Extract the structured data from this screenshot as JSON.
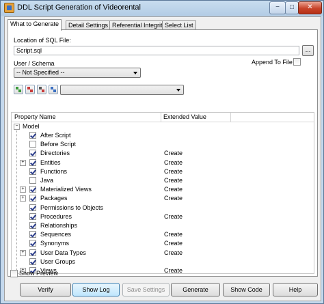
{
  "window": {
    "title": "DDL Script Generation of Videorental",
    "minimize": "−",
    "maximize": "□",
    "close": "✕"
  },
  "tabs": [
    {
      "label": "What to Generate",
      "active": true
    },
    {
      "label": "Detail Settings",
      "active": false
    },
    {
      "label": "Referential Integrity",
      "active": false
    },
    {
      "label": "Select List",
      "active": false
    }
  ],
  "sql_file": {
    "label": "Location of SQL File:",
    "value": "Script.sql",
    "browse_label": "..."
  },
  "schema": {
    "label": "User / Schema",
    "value": "-- Not Specified --"
  },
  "append": {
    "label": "Append To File",
    "checked": false
  },
  "toolbar": {
    "icons": [
      "select-all-icon",
      "deselect-all-icon",
      "expand-icon",
      "options-icon"
    ],
    "combo_value": ""
  },
  "grid": {
    "columns": [
      "Property Name",
      "Extended Value"
    ],
    "root": "Model",
    "rows": [
      {
        "name": "After Script",
        "checked": true,
        "value": "",
        "expandable": false
      },
      {
        "name": "Before Script",
        "checked": false,
        "value": "",
        "expandable": false
      },
      {
        "name": "Directories",
        "checked": true,
        "value": "Create",
        "expandable": false
      },
      {
        "name": "Entities",
        "checked": true,
        "value": "Create",
        "expandable": true
      },
      {
        "name": "Functions",
        "checked": true,
        "value": "Create",
        "expandable": false
      },
      {
        "name": "Java",
        "checked": false,
        "value": "Create",
        "expandable": false
      },
      {
        "name": "Materialized Views",
        "checked": true,
        "value": "Create",
        "expandable": true
      },
      {
        "name": "Packages",
        "checked": true,
        "value": "Create",
        "expandable": true
      },
      {
        "name": "Permissions to Objects",
        "checked": true,
        "value": "",
        "expandable": false
      },
      {
        "name": "Procedures",
        "checked": true,
        "value": "Create",
        "expandable": false
      },
      {
        "name": "Relationships",
        "checked": true,
        "value": "",
        "expandable": false
      },
      {
        "name": "Sequences",
        "checked": true,
        "value": "Create",
        "expandable": false
      },
      {
        "name": "Synonyms",
        "checked": true,
        "value": "Create",
        "expandable": false
      },
      {
        "name": "User Data Types",
        "checked": true,
        "value": "Create",
        "expandable": true
      },
      {
        "name": "User Groups",
        "checked": true,
        "value": "",
        "expandable": false
      },
      {
        "name": "Views",
        "checked": true,
        "value": "Create",
        "expandable": true
      }
    ]
  },
  "show_preview": {
    "label": "Show Preview",
    "checked": false
  },
  "buttons": {
    "verify": "Verify",
    "show_log": "Show Log",
    "save_settings": "Save Settings",
    "generate": "Generate",
    "show_code": "Show Code",
    "help": "Help"
  },
  "colors": {
    "titlebar": "#b3cce5",
    "check_mark": "#2a3c8a",
    "close_button": "#c8442a"
  }
}
